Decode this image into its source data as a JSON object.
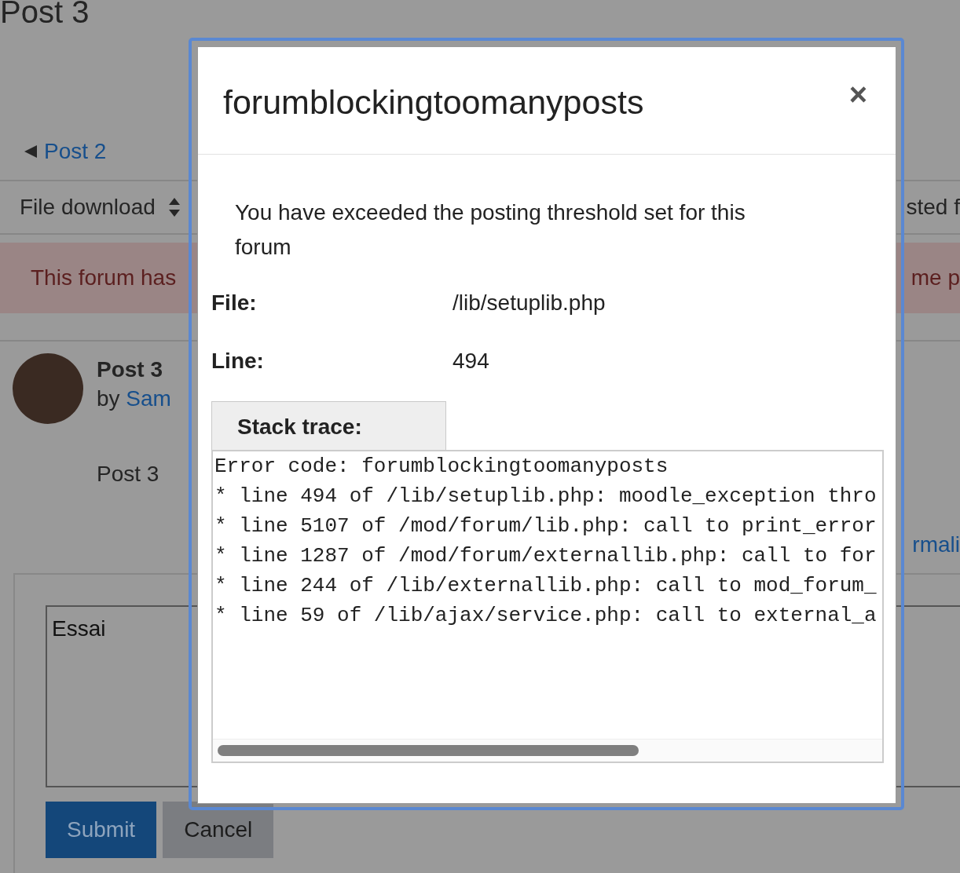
{
  "page": {
    "heading": "Post 3",
    "prev_link": "Post 2",
    "display_select": "File download",
    "display_right": "sted f",
    "alert_left": "This forum has",
    "alert_right": "me p",
    "post": {
      "title": "Post 3",
      "by": "by",
      "author": "Sam",
      "body": "Post 3",
      "link_fragment": "rmali"
    },
    "reply": {
      "value": "Essai",
      "buttons": [
        {
          "label": "Submit",
          "kind": "primary"
        },
        {
          "label": "Cancel",
          "kind": "secondary"
        }
      ]
    }
  },
  "dialog": {
    "title": "forumblockingtoomanyposts",
    "close": "×",
    "message": "You have exceeded the posting threshold set for this forum",
    "fields": [
      {
        "label": "File:",
        "value": "/lib/setuplib.php"
      },
      {
        "label": "Line:",
        "value": "494"
      }
    ],
    "stack_trace_label": "Stack trace:",
    "stack_trace": [
      "Error code: forumblockingtoomanyposts",
      "* line 494 of /lib/setuplib.php: moodle_exception thro",
      "* line 5107 of /mod/forum/lib.php: call to print_error",
      "* line 1287 of /mod/forum/externallib.php: call to for",
      "* line 244 of /lib/externallib.php: call to mod_forum_",
      "* line 59 of /lib/ajax/service.php: call to external_a"
    ]
  }
}
